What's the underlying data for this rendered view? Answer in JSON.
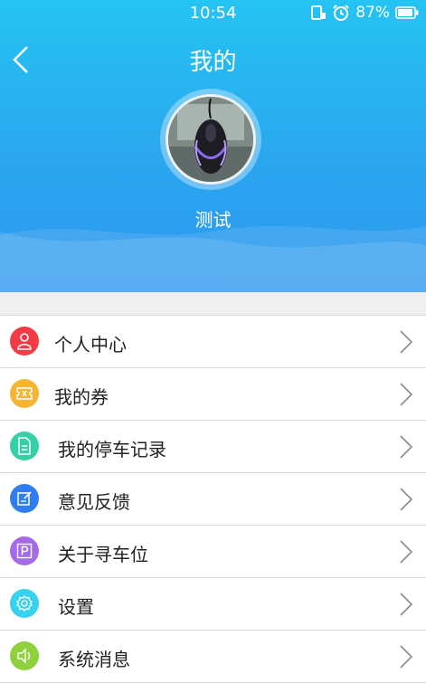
{
  "status": {
    "time": "10:54",
    "battery": "87%"
  },
  "header": {
    "title": "我的",
    "username": "测试"
  },
  "menu": [
    {
      "label": "个人中心",
      "icon": "person-icon",
      "color": "#f23b45"
    },
    {
      "label": "我的券",
      "icon": "coupon-icon",
      "color": "#f5b531"
    },
    {
      "label": "我的停车记录",
      "icon": "document-icon",
      "color": "#35d0a8"
    },
    {
      "label": "意见反馈",
      "icon": "edit-icon",
      "color": "#2f7df0"
    },
    {
      "label": "关于寻车位",
      "icon": "parking-icon",
      "color": "#a56ae8"
    },
    {
      "label": "设置",
      "icon": "gear-icon",
      "color": "#36d3f0"
    },
    {
      "label": "系统消息",
      "icon": "speaker-icon",
      "color": "#8fd13c"
    }
  ],
  "colors": {
    "header_top": "#25c4f3",
    "header_bottom": "#2f98ee"
  }
}
